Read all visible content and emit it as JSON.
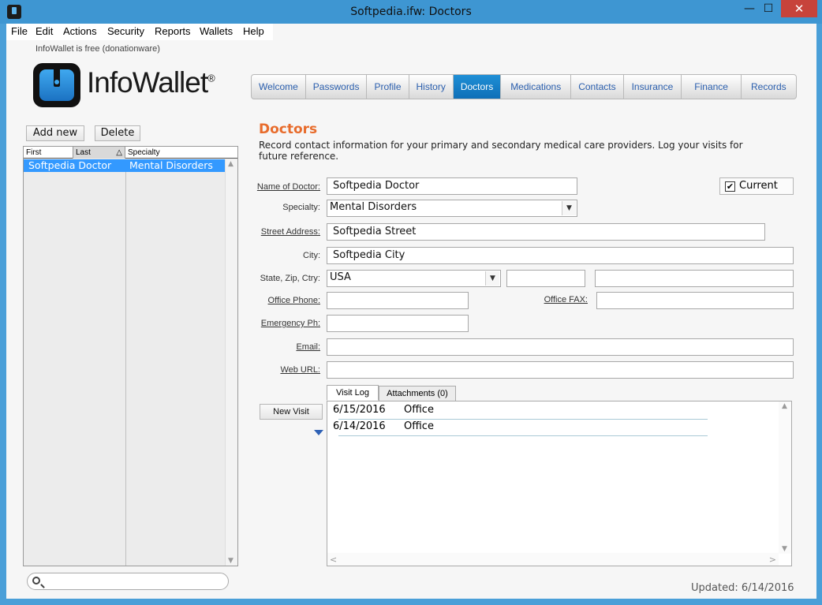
{
  "window": {
    "title": "Softpedia.ifw: Doctors",
    "min_glyph": "—",
    "max_glyph": "☐",
    "close_glyph": "✕"
  },
  "menu": {
    "items": [
      "File",
      "Edit",
      "Actions",
      "Security",
      "Reports",
      "Wallets",
      "Help"
    ]
  },
  "header": {
    "donation_text": "InfoWallet is free (donationware)",
    "logo_text": "InfoWallet",
    "logo_mark": "®"
  },
  "tabs": {
    "items": [
      {
        "label": "Welcome"
      },
      {
        "label": "Passwords"
      },
      {
        "label": "Profile"
      },
      {
        "label": "History"
      },
      {
        "label": "Doctors"
      },
      {
        "label": "Medications"
      },
      {
        "label": "Contacts"
      },
      {
        "label": "Insurance"
      },
      {
        "label": "Finance"
      },
      {
        "label": "Records"
      }
    ],
    "active": "Doctors"
  },
  "list_panel": {
    "add_label": "Add new",
    "delete_label": "Delete",
    "columns": [
      "First",
      "Last",
      "Specialty"
    ],
    "sort_glyph": "△",
    "rows": [
      {
        "name": "Softpedia Doctor",
        "specialty": "Mental Disorders",
        "selected": true
      }
    ]
  },
  "section": {
    "title": "Doctors",
    "description": "Record contact information for your primary and secondary medical care providers. Log your visits for future reference."
  },
  "form": {
    "name_label": "Name of Doctor:",
    "name_value": "Softpedia Doctor",
    "specialty_label": "Specialty:",
    "specialty_value": "Mental Disorders",
    "current_label": "Current",
    "current_checked": "✔",
    "street_label": "Street Address:",
    "street_value": "Softpedia Street",
    "city_label": "City:",
    "city_value": "Softpedia City",
    "state_label": "State, Zip, Ctry:",
    "state_value": "USA",
    "zip_value": "",
    "country_value": "",
    "phone_label": "Office Phone:",
    "phone_value": "",
    "fax_label": "Office FAX:",
    "fax_value": "",
    "emergency_label": "Emergency Ph:",
    "emergency_value": "",
    "email_label": "Email:",
    "email_value": "",
    "web_label": "Web URL:",
    "web_value": ""
  },
  "visits": {
    "new_visit_label": "New Visit",
    "tabs": [
      {
        "label": "Visit Log"
      },
      {
        "label": "Attachments (0)"
      }
    ],
    "rows": [
      {
        "date": "6/15/2016",
        "type": "Office"
      },
      {
        "date": "6/14/2016",
        "type": "Office"
      }
    ]
  },
  "footer": {
    "updated_text": "Updated: 6/14/2016"
  },
  "icons": {
    "dropdown_arrow": "chevron-down-icon",
    "scroll_up": "▲",
    "scroll_down": "▼",
    "scroll_left": "<",
    "scroll_right": ">"
  },
  "colors": {
    "title_bar": "#3e96d2",
    "accent_tab": "#1f8fd6",
    "section_title": "#e86c2c",
    "selection": "#3399ff",
    "close_button": "#c7433b"
  }
}
